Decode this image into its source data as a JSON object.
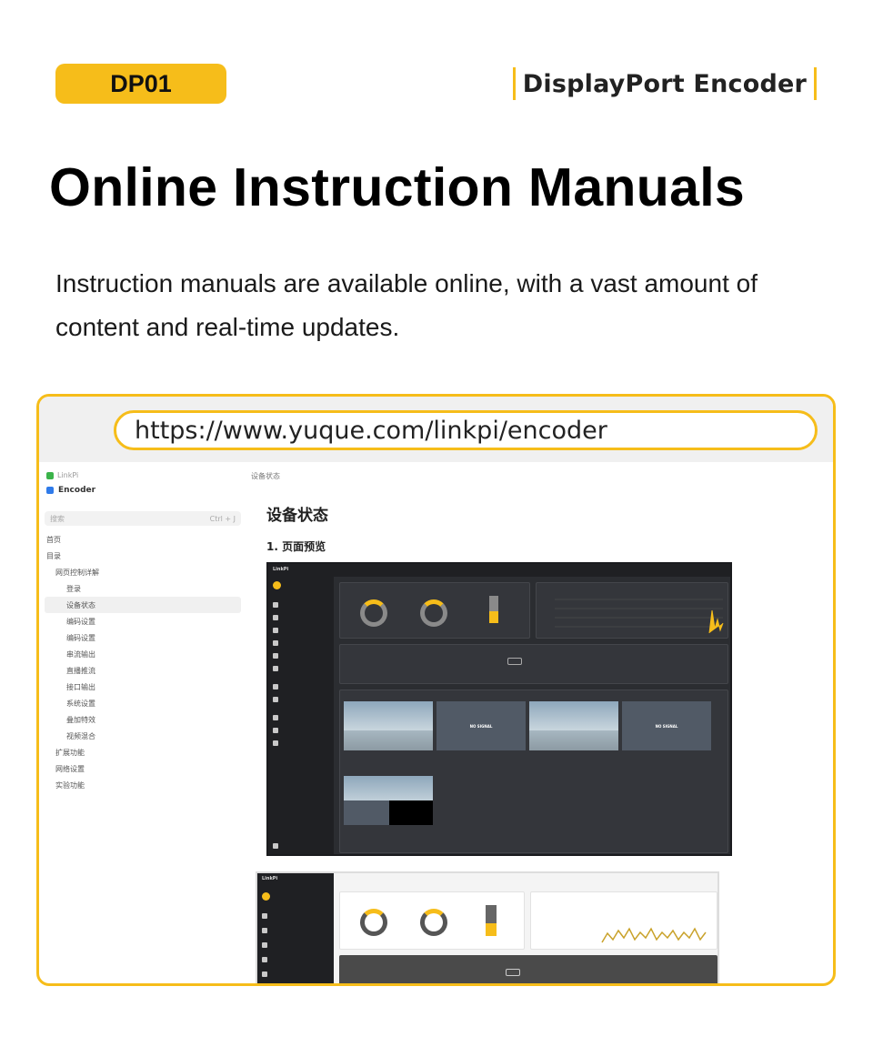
{
  "badge": "DP01",
  "product": "DisplayPort Encoder",
  "heading": "Online Instruction Manuals",
  "description": "Instruction manuals are available online, with a vast amount of content and real-time updates.",
  "url": "https://www.yuque.com/linkpi/encoder",
  "sidebar": {
    "crumb": "LinkPi",
    "space": "Encoder",
    "search_placeholder": "搜索",
    "search_shortcut": "Ctrl + J",
    "items": [
      {
        "label": "首页",
        "level": "top"
      },
      {
        "label": "目录",
        "level": "top"
      },
      {
        "label": "网页控制详解",
        "level": "l1"
      },
      {
        "label": "登录",
        "level": "sub"
      },
      {
        "label": "设备状态",
        "level": "sub",
        "active": true
      },
      {
        "label": "编码设置",
        "level": "sub"
      },
      {
        "label": "编码设置",
        "level": "sub"
      },
      {
        "label": "串流输出",
        "level": "sub"
      },
      {
        "label": "直播推流",
        "level": "sub"
      },
      {
        "label": "接口输出",
        "level": "sub"
      },
      {
        "label": "系统设置",
        "level": "sub"
      },
      {
        "label": "叠加特效",
        "level": "sub"
      },
      {
        "label": "视频混合",
        "level": "sub"
      },
      {
        "label": "扩展功能",
        "level": "l1"
      },
      {
        "label": "网络设置",
        "level": "l1"
      },
      {
        "label": "实验功能",
        "level": "l1"
      }
    ]
  },
  "doc": {
    "top_crumb": "设备状态",
    "title": "设备状态",
    "section": "1. 页面预览"
  },
  "app": {
    "logo": "LinkPi",
    "no_signal": "NO SIGNAL"
  },
  "colors": {
    "accent": "#f6bd1a"
  }
}
